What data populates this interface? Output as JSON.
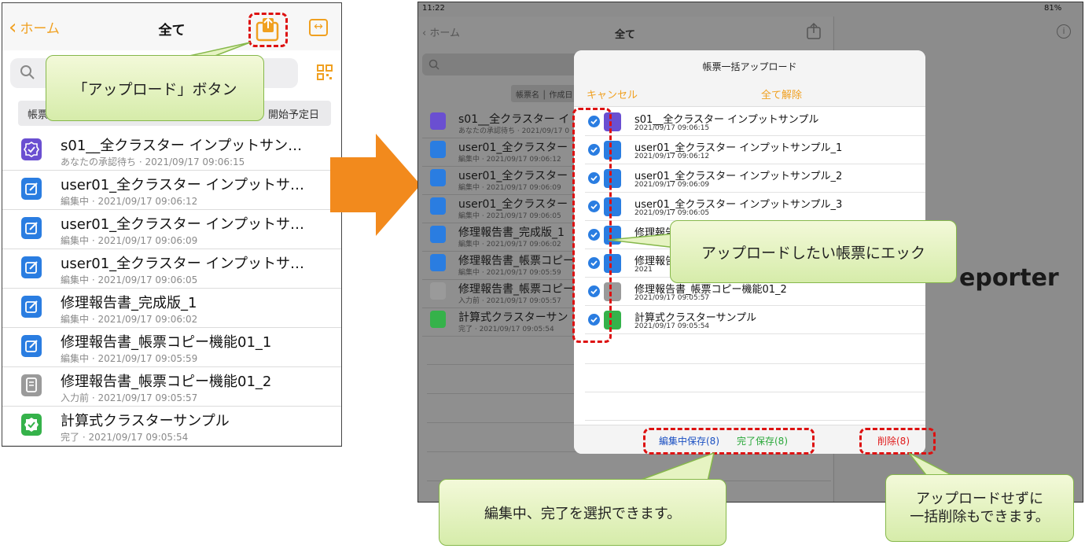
{
  "phone": {
    "back_label": "ホーム",
    "title": "全て",
    "sort_left": "帳票",
    "sort_right": "開始予定日",
    "rows": [
      {
        "title": "s01__全クラスター インプットサン…",
        "meta": "あなたの承認待ち · 2021/09/17 09:06:15",
        "icon": "approval-icon"
      },
      {
        "title": "user01_全クラスター インプットサ…",
        "meta": "編集中 · 2021/09/17 09:06:12",
        "icon": "edit-icon"
      },
      {
        "title": "user01_全クラスター インプットサ…",
        "meta": "編集中 · 2021/09/17 09:06:09",
        "icon": "edit-icon"
      },
      {
        "title": "user01_全クラスター インプットサ…",
        "meta": "編集中 · 2021/09/17 09:06:05",
        "icon": "edit-icon"
      },
      {
        "title": "修理報告書_完成版_1",
        "meta": "編集中 · 2021/09/17 09:06:02",
        "icon": "edit-icon"
      },
      {
        "title": "修理報告書_帳票コピー機能01_1",
        "meta": "編集中 · 2021/09/17 09:05:59",
        "icon": "edit-icon"
      },
      {
        "title": "修理報告書_帳票コピー機能01_2",
        "meta": "入力前 · 2021/09/17 09:05:57",
        "icon": "document-icon"
      },
      {
        "title": "計算式クラスターサンプル",
        "meta": "完了 · 2021/09/17 09:05:54",
        "icon": "complete-icon"
      }
    ]
  },
  "callouts": {
    "upload_button": "「アップロード」ボタン",
    "check_forms": "アップロードしたい帳票にエック",
    "select_status": "編集中、完了を選択できます。",
    "bulk_delete_line1": "アップロードせずに",
    "bulk_delete_line2": "一括削除もできます。"
  },
  "ipad": {
    "time": "11:22",
    "battery": "81%",
    "back_label": "ホーム",
    "title": "全て",
    "sort_label": "帳票名 │ 作成日",
    "right_pane_text": "eporter",
    "rows": [
      {
        "title": "s01__全クラスター イ",
        "meta": "あなたの承認待ち · 2021/09/17 0"
      },
      {
        "title": "user01_全クラスター",
        "meta": "編集中 · 2021/09/17 09:06:12"
      },
      {
        "title": "user01_全クラスター",
        "meta": "編集中 · 2021/09/17 09:06:09"
      },
      {
        "title": "user01_全クラスター",
        "meta": "編集中 · 2021/09/17 09:06:05"
      },
      {
        "title": "修理報告書_完成版_1",
        "meta": "編集中 · 2021/09/17 09:06:02"
      },
      {
        "title": "修理報告書_帳票コピー",
        "meta": "編集中 · 2021/09/17 09:05:59"
      },
      {
        "title": "修理報告書_帳票コピー",
        "meta": "入力前 · 2021/09/17 09:05:57"
      },
      {
        "title": "計算式クラスターサン",
        "meta": "完了 · 2021/09/17 09:05:54"
      }
    ]
  },
  "modal": {
    "title": "帳票一括アップロード",
    "cancel": "キャンセル",
    "clear_all": "全て解除",
    "save_editing": "編集中保存(8)",
    "save_complete": "完了保存(8)",
    "delete": "削除(8)",
    "rows": [
      {
        "title": "s01__全クラスター インプットサンプル",
        "date": "2021/09/17 09:06:15"
      },
      {
        "title": "user01_全クラスター インプットサンプル_1",
        "date": "2021/09/17 09:06:12"
      },
      {
        "title": "user01_全クラスター インプットサンプル_2",
        "date": "2021/09/17 09:06:09"
      },
      {
        "title": "user01_全クラスター インプットサンプル_3",
        "date": "2021/09/17 09:06:05"
      },
      {
        "title": "修理報告",
        "date": "2021"
      },
      {
        "title": "修理報告",
        "date": "2021"
      },
      {
        "title": "修理報告書_帳票コピー機能01_2",
        "date": "2021/09/17 09:05:57"
      },
      {
        "title": "計算式クラスターサンプル",
        "date": "2021/09/17 09:05:54"
      }
    ]
  },
  "colors": {
    "accent_orange": "#f0a020",
    "highlight_red": "#dd1111",
    "edit_blue": "#2a7de1",
    "approval_purple": "#6a4fd1",
    "complete_green": "#35b24a",
    "callout_green": "#d6ecaa"
  }
}
